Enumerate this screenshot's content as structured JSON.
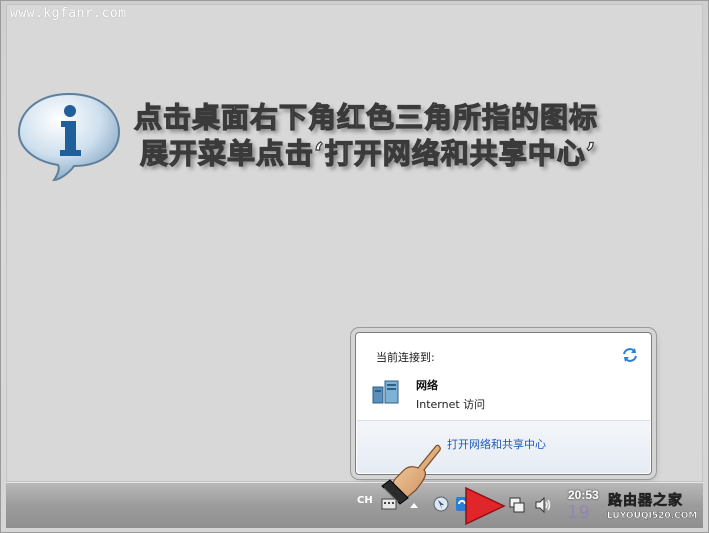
{
  "watermark_top_left": "www.kgfanr.com",
  "instruction": {
    "line1": "点击桌面右下角红色三角所指的图标",
    "line2": "展开菜单点击‘打开网络和共享中心’"
  },
  "network_popup": {
    "header": "当前连接到:",
    "network_name": "网络",
    "network_status": "Internet 访问",
    "open_center_link": "打开网络和共享中心"
  },
  "taskbar": {
    "language": "CH",
    "clock_time": "20:53",
    "faint_date": "19"
  },
  "watermark_bottom_right": {
    "cn": "路由器之家",
    "en": "LUYOUQI520.COM"
  },
  "colors": {
    "link": "#1c5ab5",
    "pointer_arrow": "#e0252b",
    "taskbar": "#9c9c9c"
  },
  "icons": [
    "info-bubble-icon",
    "refresh-icon",
    "network-icon",
    "hand-pointer-icon",
    "red-triangle-arrow-icon",
    "keyboard-icon",
    "network-tray-icon",
    "volume-icon"
  ]
}
